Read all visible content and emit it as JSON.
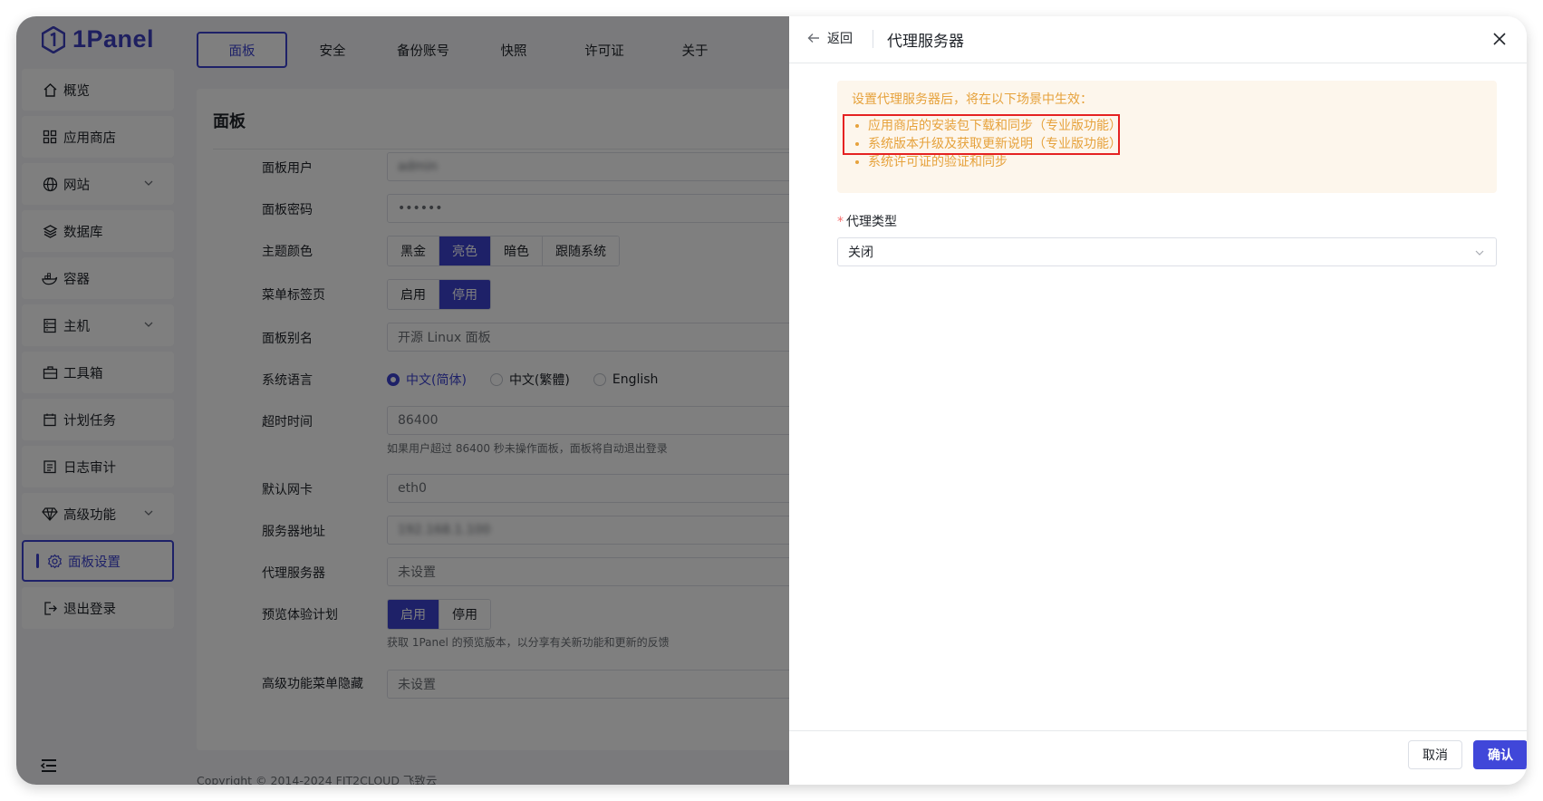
{
  "app": {
    "logo_text": "1Panel",
    "brand_color": "#3c43d1"
  },
  "sidebar": {
    "items": [
      {
        "label": "概览",
        "icon": "home-icon"
      },
      {
        "label": "应用商店",
        "icon": "grid-icon"
      },
      {
        "label": "网站",
        "icon": "globe-icon",
        "expandable": true
      },
      {
        "label": "数据库",
        "icon": "layers-icon"
      },
      {
        "label": "容器",
        "icon": "docker-icon"
      },
      {
        "label": "主机",
        "icon": "server-icon",
        "expandable": true
      },
      {
        "label": "工具箱",
        "icon": "toolbox-icon"
      },
      {
        "label": "计划任务",
        "icon": "calendar-icon"
      },
      {
        "label": "日志审计",
        "icon": "log-icon"
      },
      {
        "label": "高级功能",
        "icon": "diamond-icon",
        "expandable": true
      },
      {
        "label": "面板设置",
        "icon": "gear-icon",
        "active": true
      },
      {
        "label": "退出登录",
        "icon": "logout-icon"
      }
    ]
  },
  "tabs": [
    "面板",
    "安全",
    "备份账号",
    "快照",
    "许可证",
    "关于"
  ],
  "panel": {
    "title": "面板",
    "rows": {
      "user": {
        "label": "面板用户",
        "value": "admin"
      },
      "password": {
        "label": "面板密码",
        "value": "••••••"
      },
      "theme": {
        "label": "主题颜色",
        "options": [
          "黑金",
          "亮色",
          "暗色",
          "跟随系统"
        ],
        "selected": "亮色"
      },
      "menu_tabs": {
        "label": "菜单标签页",
        "options": [
          "启用",
          "停用"
        ],
        "selected": "停用"
      },
      "alias": {
        "label": "面板别名",
        "value": "开源 Linux 面板"
      },
      "language": {
        "label": "系统语言",
        "options": [
          "中文(简体)",
          "中文(繁體)",
          "English"
        ],
        "selected": "中文(简体)"
      },
      "timeout": {
        "label": "超时时间",
        "value": "86400",
        "help": "如果用户超过 86400 秒未操作面板，面板将自动退出登录"
      },
      "nic": {
        "label": "默认网卡",
        "value": "eth0"
      },
      "server_addr": {
        "label": "服务器地址",
        "value": "192.168.1.100"
      },
      "proxy": {
        "label": "代理服务器",
        "value": "未设置"
      },
      "preview": {
        "label": "预览体验计划",
        "options": [
          "启用",
          "停用"
        ],
        "selected": "启用",
        "help": "获取 1Panel 的预览版本，以分享有关新功能和更新的反馈"
      },
      "hidden_menu": {
        "label": "高级功能菜单隐藏",
        "value": "未设置"
      }
    }
  },
  "footer": {
    "copyright": "Copyright © 2014-2024 FIT2CLOUD 飞致云"
  },
  "drawer": {
    "back_label": "返回",
    "title": "代理服务器",
    "alert": {
      "title": "设置代理服务器后，将在以下场景中生效：",
      "items": [
        "应用商店的安装包下载和同步（专业版功能）",
        "系统版本升级及获取更新说明（专业版功能）",
        "系统许可证的验证和同步"
      ]
    },
    "proxy_type": {
      "label": "代理类型",
      "value": "关闭"
    },
    "cancel_label": "取消",
    "confirm_label": "确认"
  }
}
